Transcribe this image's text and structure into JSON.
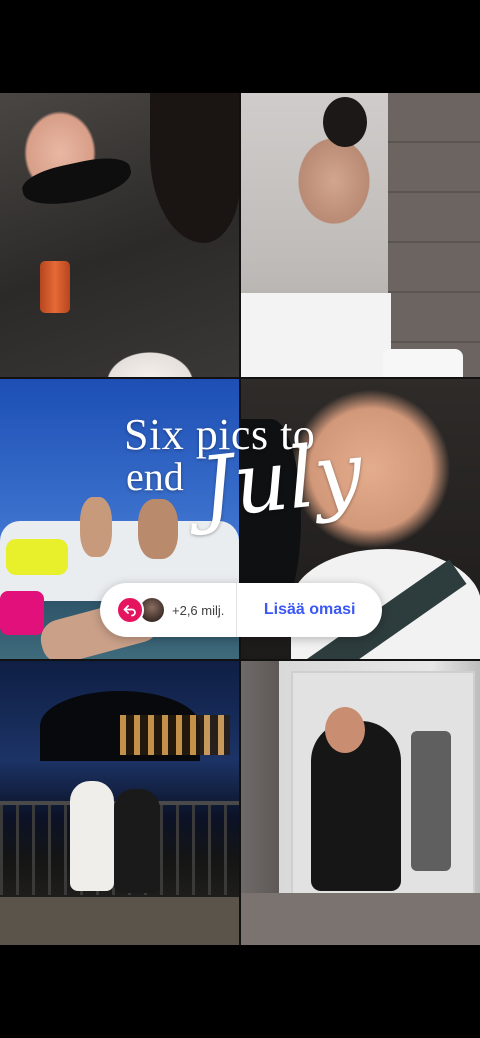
{
  "story": {
    "title_line1": "Six pics to",
    "title_line2": "end",
    "title_script": "July"
  },
  "add_yours": {
    "count": "+2,6 milj.",
    "cta_label": "Lisää omasi",
    "reply_icon": "reply-arrow-icon",
    "accent_color": "#3b57f5",
    "icon_color": "#e4145f"
  },
  "photos": [
    {
      "name": "photo-selfie-friends"
    },
    {
      "name": "photo-shower"
    },
    {
      "name": "photo-boat"
    },
    {
      "name": "photo-car-selfie"
    },
    {
      "name": "photo-night-river"
    },
    {
      "name": "photo-mirror-selfie"
    }
  ]
}
